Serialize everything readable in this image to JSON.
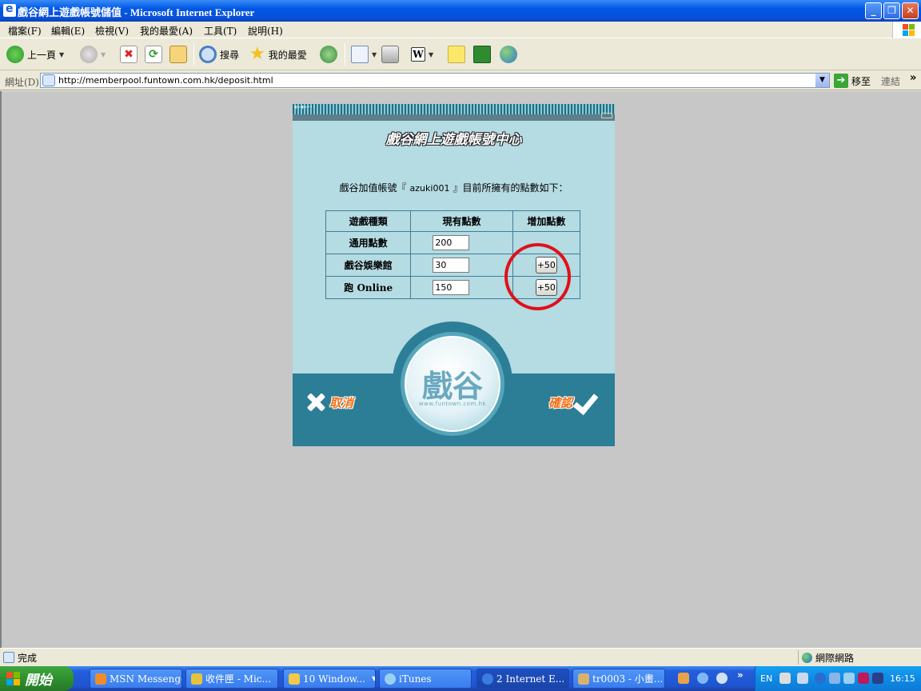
{
  "window": {
    "title": "戲谷網上遊戲帳號儲值 - Microsoft Internet Explorer"
  },
  "menu": [
    "檔案(F)",
    "編輯(E)",
    "檢視(V)",
    "我的最愛(A)",
    "工具(T)",
    "說明(H)"
  ],
  "toolbar": {
    "back": "上一頁",
    "search": "搜尋",
    "favorites": "我的最愛"
  },
  "address": {
    "label": "網址(D)",
    "url": "http://memberpool.funtown.com.hk/deposit.html",
    "go": "移至",
    "links": "連結"
  },
  "page": {
    "strip_label": "←←···",
    "heading": "戲谷網上遊戲帳號中心",
    "intro_before": "戲谷加值帳號『",
    "account": "azuki001",
    "intro_after": "』目前所擁有的點數如下：",
    "table": {
      "headers": [
        "遊戲種類",
        "現有點數",
        "增加點數"
      ],
      "rows": [
        {
          "game": "通用點數",
          "points": "200",
          "add": ""
        },
        {
          "game": "戲谷娛樂館",
          "points": "30",
          "add": "+50"
        },
        {
          "game": "跑 Online",
          "points": "150",
          "add": "+50"
        }
      ]
    },
    "cancel": "取消",
    "confirm": "確認",
    "logo_text": "戲谷",
    "logo_url": "www.funtown.com.hk"
  },
  "status": {
    "text": "完成",
    "zone": "網際網路"
  },
  "taskbar": {
    "start": "開始",
    "tasks": [
      {
        "label": "MSN Messenger",
        "color": "#f08c2a"
      },
      {
        "label": "收件匣 - Mic...",
        "color": "#e8c23a"
      },
      {
        "label": "10 Window...",
        "color": "#f2c94a"
      },
      {
        "label": "iTunes",
        "color": "#9ad0f5"
      },
      {
        "label": "2 Internet E...",
        "color": "#3a7ce0"
      },
      {
        "label": "tr0003 - 小畫...",
        "color": "#d9b36b"
      }
    ],
    "lang": "EN",
    "clock": "16:15"
  },
  "colors": {
    "accent_red": "#e0101a",
    "panel_bg": "#b5dbe3",
    "panel_dark": "#2b7e96",
    "button_orange": "#f26e14"
  }
}
